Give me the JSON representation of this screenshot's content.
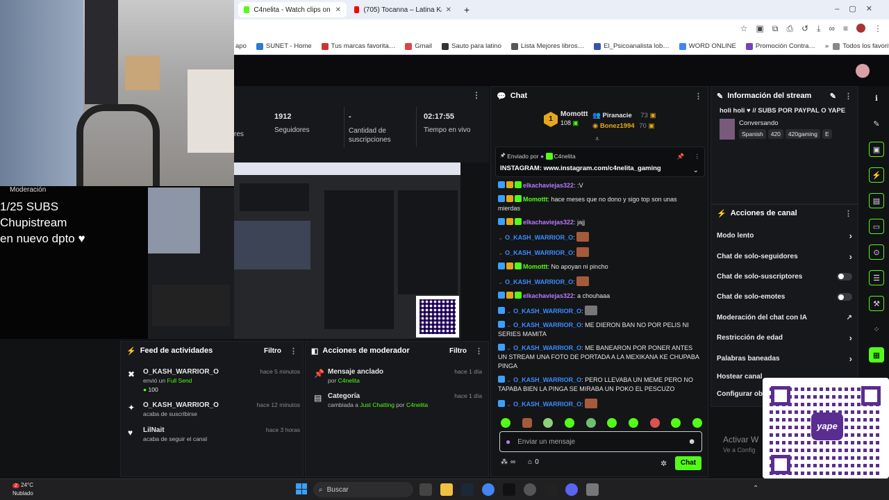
{
  "browser": {
    "tabs": [
      {
        "label": "C4nelita - Watch clips on Kick",
        "active": true
      },
      {
        "label": "(705) Tocanna – Latina Kawaii (…",
        "active": false
      }
    ],
    "bookmarks": [
      "SUNET - Home",
      "Tus marcas favorita…",
      "Gmail",
      "Sauto para latino",
      "Lista Mejores libros…",
      "El_Psicoanalista lob…",
      "WORD ONLINE",
      "Promoción Contra…"
    ],
    "bookmarks_folder": "Todos los favoritos",
    "bookmarks_trunc": "apo"
  },
  "overlay": {
    "text_line1": "1/25 SUBS",
    "text_line2": "Chupistream",
    "text_line3": "en nuevo dpto ♥",
    "moderation_label": "Moderación"
  },
  "stats": {
    "prefix": "res",
    "followers_value": "1912",
    "followers_label": "Seguidores",
    "subs_value": "-",
    "subs_label": "Cantidad de suscripciones",
    "time_value": "02:17:55",
    "time_label": "Tiempo en vivo"
  },
  "activity": {
    "title": "Feed de actividades",
    "filter": "Filtro",
    "items": [
      {
        "user": "O_KASH_WARRIOR_O",
        "time": "hace 5 minutos",
        "action_pre": "envió un ",
        "action_highlight": "Full Send",
        "amount": "100"
      },
      {
        "user": "O_KASH_WARRIOR_O",
        "time": "hace 12 minutos",
        "action_pre": "acaba de suscribirse",
        "action_highlight": "",
        "amount": ""
      },
      {
        "user": "LilNait",
        "time": "hace 3 horas",
        "action_pre": "acaba de seguir el canal",
        "action_highlight": "",
        "amount": ""
      }
    ]
  },
  "modactions": {
    "title": "Acciones de moderador",
    "filter": "Filtro",
    "items": [
      {
        "title": "Mensaje anclado",
        "time": "hace 1 día",
        "sub_pre": "por ",
        "sub_hl": "C4nelita",
        "sub_mid": "",
        "sub_hl2": ""
      },
      {
        "title": "Categoría",
        "time": "hace 1 día",
        "sub_pre": "cambiada a ",
        "sub_hl": "Just Chatting",
        "sub_mid": " por ",
        "sub_hl2": "C4nelita"
      }
    ]
  },
  "chat": {
    "title": "Chat",
    "top": [
      {
        "rank": "1",
        "name": "Momottt",
        "value": "108"
      },
      {
        "rank": "",
        "name": "Piranacie",
        "value": "73"
      },
      {
        "rank": "",
        "name": "Bonez1994",
        "value": "70"
      }
    ],
    "pinned_by_label": "Enviado por",
    "pinned_by": "C4nelita",
    "pinned_text": "INSTAGRAM: www.instagram.com/c4nelita_gaming",
    "messages": [
      {
        "user": "elkachaviejas322",
        "color": "#b77bff",
        "text": ":V"
      },
      {
        "user": "Momottt",
        "color": "#53fc18",
        "text": "hace meses que no dono y sigo top son unas mierdas"
      },
      {
        "user": "elkachaviejas322",
        "color": "#b77bff",
        "text": "jajj"
      },
      {
        "user": "O_KASH_WARRIOR_O",
        "color": "#3b8cff",
        "text": ""
      },
      {
        "user": "O_KASH_WARRIOR_O",
        "color": "#3b8cff",
        "text": ""
      },
      {
        "user": "Momottt",
        "color": "#53fc18",
        "text": "No apoyan ni pincho"
      },
      {
        "user": "O_KASH_WARRIOR_O",
        "color": "#3b8cff",
        "text": ""
      },
      {
        "user": "elkachaviejas322",
        "color": "#b77bff",
        "text": "a chouhaaa"
      },
      {
        "user": "O_KASH_WARRIOR_O",
        "color": "#3b8cff",
        "text": ""
      },
      {
        "user": "O_KASH_WARRIOR_O",
        "color": "#3b8cff",
        "text": "ME DIERON BAN NO POR PELIS NI SERIES MAMITA"
      },
      {
        "user": "O_KASH_WARRIOR_O",
        "color": "#3b8cff",
        "text": "ME BANEARON POR PONER ANTES UN STREAM UNA FOTO DE PORTADA A LA MEXIKANA KE CHUPABA PINGA"
      },
      {
        "user": "O_KASH_WARRIOR_O",
        "color": "#3b8cff",
        "text": "PERO LLEVABA UN MEME PERO NO TAPABA BIEN LA PINGA SE MIRABA UN POKO EL PESCUZO"
      },
      {
        "user": "O_KASH_WARRIOR_O",
        "color": "#3b8cff",
        "text": ""
      }
    ],
    "input_placeholder": "Enviar un mensaje",
    "points": "∞",
    "gift_count": "0",
    "send_label": "Chat"
  },
  "streaminfo": {
    "title": "Información del stream",
    "stream_title": "holi holi ♥ // SUBS POR PAYPAL O YAPE",
    "category": "Conversando",
    "tags": [
      "Spanish",
      "420",
      "420gaming",
      "E"
    ]
  },
  "channelactions": {
    "title": "Acciones de canal",
    "items": [
      {
        "label": "Modo lento",
        "control": "chevron"
      },
      {
        "label": "Chat de solo-seguidores",
        "control": "chevron"
      },
      {
        "label": "Chat de solo-suscriptores",
        "control": "toggle"
      },
      {
        "label": "Chat de solo-emotes",
        "control": "toggle"
      },
      {
        "label": "Moderación del chat con IA",
        "control": "external"
      },
      {
        "label": "Restricción de edad",
        "control": "chevron"
      },
      {
        "label": "Palabras baneadas",
        "control": "chevron"
      },
      {
        "label": "Hostear canal",
        "control": "none"
      },
      {
        "label": "Configurar ob",
        "control": "none"
      }
    ]
  },
  "watermark": {
    "line1": "Activar W",
    "line2": "Ve a Config"
  },
  "qr": {
    "label": "yape"
  },
  "taskbar": {
    "weather_temp": "24°C",
    "weather_desc": "Nublado",
    "search": "Buscar",
    "badge": "2"
  },
  "colors": {
    "accent": "#53fc18",
    "bg": "#111214",
    "panel": "#17181b"
  }
}
